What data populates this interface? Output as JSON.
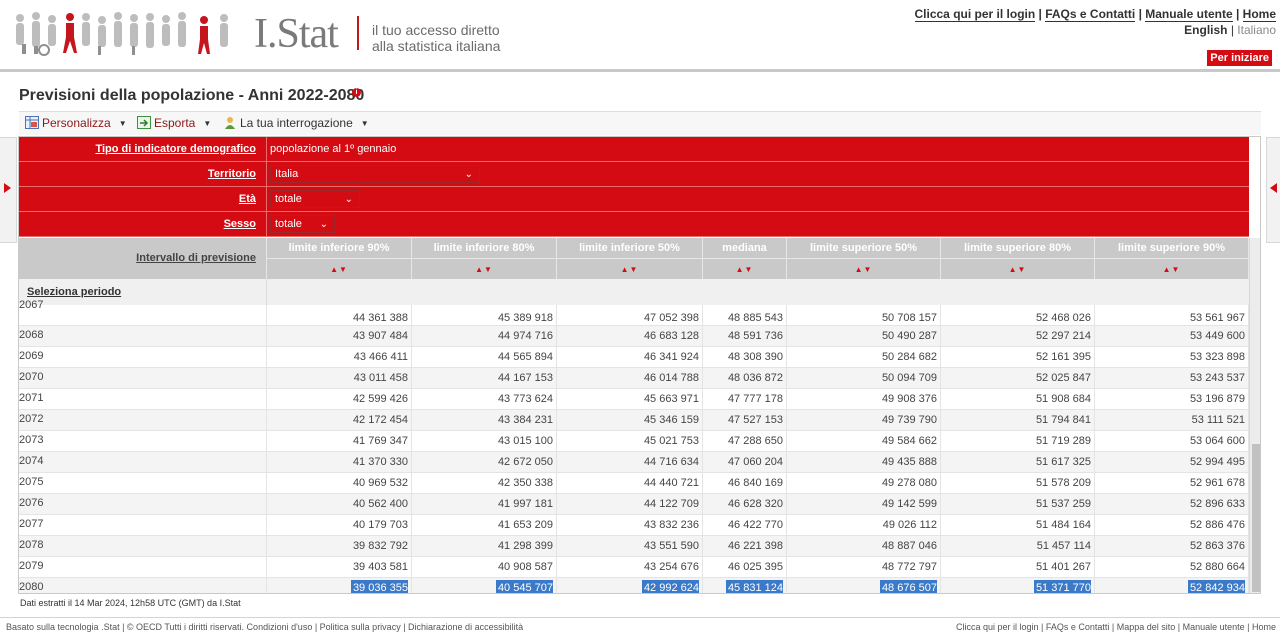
{
  "header": {
    "logo": "I.Stat",
    "tagline_line1": "il tuo accesso diretto",
    "tagline_line2": "alla statistica italiana",
    "links": [
      "Clicca qui per il login",
      "FAQs e Contatti",
      "Manuale utente",
      "Home"
    ],
    "lang_current": "English",
    "lang_other": "Italiano",
    "start_button": "Per iniziare"
  },
  "page_title": "Previsioni della popolazione - Anni 2022-2080",
  "info_icon": "i",
  "toolbar": {
    "customize": "Personalizza",
    "export": "Esporta",
    "query": "La tua interrogazione"
  },
  "selectors": {
    "indicator_label": "Tipo di indicatore demografico",
    "indicator_value": "popolazione al 1º gennaio",
    "territory_label": "Territorio",
    "territory_value": "Italia",
    "age_label": "Età",
    "age_value": "totale",
    "sex_label": "Sesso",
    "sex_value": "totale"
  },
  "table": {
    "row_header": "Intervallo di previsione",
    "select_period": "Seleziona periodo",
    "columns": [
      "limite inferiore 90%",
      "limite inferiore 80%",
      "limite inferiore 50%",
      "mediana",
      "limite superiore 50%",
      "limite superiore 80%",
      "limite superiore 90%"
    ],
    "sort_glyph": "▲▼",
    "rows": [
      {
        "year": "2067",
        "values": [
          "44 361 388",
          "45 389 918",
          "47 052 398",
          "48 885 543",
          "50 708 157",
          "52 468 026",
          "53 561 967"
        ]
      },
      {
        "year": "2068",
        "values": [
          "43 907 484",
          "44 974 716",
          "46 683 128",
          "48 591 736",
          "50 490 287",
          "52 297 214",
          "53 449 600"
        ]
      },
      {
        "year": "2069",
        "values": [
          "43 466 411",
          "44 565 894",
          "46 341 924",
          "48 308 390",
          "50 284 682",
          "52 161 395",
          "53 323 898"
        ]
      },
      {
        "year": "2070",
        "values": [
          "43 011 458",
          "44 167 153",
          "46 014 788",
          "48 036 872",
          "50 094 709",
          "52 025 847",
          "53 243 537"
        ]
      },
      {
        "year": "2071",
        "values": [
          "42 599 426",
          "43 773 624",
          "45 663 971",
          "47 777 178",
          "49 908 376",
          "51 908 684",
          "53 196 879"
        ]
      },
      {
        "year": "2072",
        "values": [
          "42 172 454",
          "43 384 231",
          "45 346 159",
          "47 527 153",
          "49 739 790",
          "51 794 841",
          "53 111 521"
        ]
      },
      {
        "year": "2073",
        "values": [
          "41 769 347",
          "43 015 100",
          "45 021 753",
          "47 288 650",
          "49 584 662",
          "51 719 289",
          "53 064 600"
        ]
      },
      {
        "year": "2074",
        "values": [
          "41 370 330",
          "42 672 050",
          "44 716 634",
          "47 060 204",
          "49 435 888",
          "51 617 325",
          "52 994 495"
        ]
      },
      {
        "year": "2075",
        "values": [
          "40 969 532",
          "42 350 338",
          "44 440 721",
          "46 840 169",
          "49 278 080",
          "51 578 209",
          "52 961 678"
        ]
      },
      {
        "year": "2076",
        "values": [
          "40 562 400",
          "41 997 181",
          "44 122 709",
          "46 628 320",
          "49 142 599",
          "51 537 259",
          "52 896 633"
        ]
      },
      {
        "year": "2077",
        "values": [
          "40 179 703",
          "41 653 209",
          "43 832 236",
          "46 422 770",
          "49 026 112",
          "51 484 164",
          "52 886 476"
        ]
      },
      {
        "year": "2078",
        "values": [
          "39 832 792",
          "41 298 399",
          "43 551 590",
          "46 221 398",
          "48 887 046",
          "51 457 114",
          "52 863 376"
        ]
      },
      {
        "year": "2079",
        "values": [
          "39 403 581",
          "40 908 587",
          "43 254 676",
          "46 025 395",
          "48 772 797",
          "51 401 267",
          "52 880 664"
        ]
      },
      {
        "year": "2080",
        "values": [
          "39 036 355",
          "40 545 707",
          "42 992 624",
          "45 831 124",
          "48 676 507",
          "51 371 770",
          "52 842 934"
        ]
      }
    ]
  },
  "footer_note_prefix": "Dati estratti il 14 Mar 2024, 12h58 UTC (GMT) da",
  "footer_note_link": "I.Stat",
  "footer_left": "Basato sulla tecnologia .Stat | © OECD Tutti i diritti riservati. Condizioni d'uso | Politica sulla privacy | Dichiarazione di accessibilità",
  "footer_right": "Clicca qui per il login | FAQs e Contatti | Mappa del sito | Manuale utente | Home",
  "colors": {
    "brand_red": "#d50b13",
    "highlight_blue": "#3b79c9",
    "header_grey": "#c9c9c9"
  }
}
